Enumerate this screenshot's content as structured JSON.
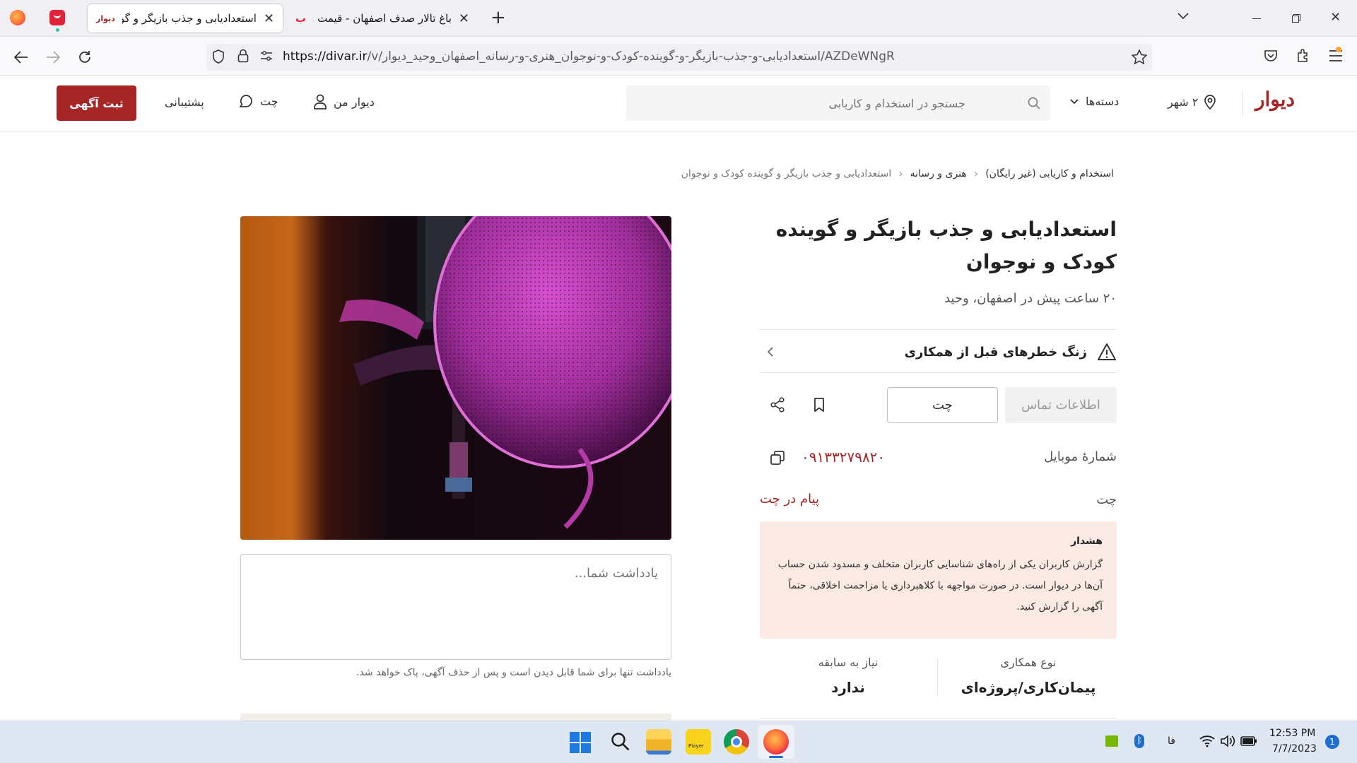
{
  "browser": {
    "tabs": [
      {
        "title": "استعدادیابی و جذب بازیگر و گو",
        "favicon_text": "دیوار",
        "active": true
      },
      {
        "title": "باغ تالار صدف اصفهان - قیمت و",
        "favicon_text": "ب",
        "active": false
      }
    ],
    "new_tab_symbol": "+",
    "url_host": "https://divar.ir",
    "url_path": "/v/استعدادیابی-و-جذب-بازیگر-و-گوینده-کودک-و-نوجوان_هنری-و-رسانه_اصفهان_وحید_دیوار/AZDeWNgR"
  },
  "header": {
    "logo": "دیوار",
    "city": "۲ شهر",
    "categories": "دسته‌ها",
    "search_placeholder": "جستجو در استخدام و کاریابی",
    "my_divar": "دیوار من",
    "chat": "چت",
    "support": "پشتیبانی",
    "post_ad": "ثبت آگهی"
  },
  "breadcrumb": [
    "استخدام و کاریابی (غیر رایگان)",
    "هنری و رسانه",
    "استعدادیابی و جذب بازیگر و گوینده کودک و نوجوان"
  ],
  "ad": {
    "title": "استعدادیابی و جذب بازیگر و گوینده کودک و نوجوان",
    "subtitle": "۲۰ ساعت پیش در اصفهان، وحید",
    "alert_text": "زنگ خطرهای قبل از همکاری",
    "contact_button": "اطلاعات تماس",
    "chat_button": "چت",
    "mobile_label": "شمارهٔ موبایل",
    "mobile_value": "۰۹۱۳۳۲۷۹۸۲۰",
    "chat_label": "چت",
    "chat_link": "پیام در چت",
    "warning_title": "هشدار",
    "warning_text": "گزارش کاربران یکی از راه‌های شناسایی کاربران متخلف و مسدود شدن حساب آن‌ها در دیوار است. در صورت مواجهه با کلاهبرداری یا مزاحمت اخلاقی، حتماً آگهی را گزارش کنید.",
    "stats": [
      {
        "label": "نوع همکاری",
        "value": "پیمان‌کاری/پروژه‌ای"
      },
      {
        "label": "نیاز به سابقه",
        "value": "ندارد"
      }
    ]
  },
  "notes": {
    "placeholder": "یادداشت شما...",
    "hint": "یادداشت تنها برای شما قابل دیدن است و پس از حذف آگهی، پاک خواهد شد."
  },
  "taskbar": {
    "language": "فا",
    "time": "12:53 PM",
    "date": "7/7/2023",
    "notification_count": "1",
    "player_label": "Player"
  },
  "colors": {
    "brand": "#a62626",
    "warning_bg": "#fbe9e3",
    "taskbar_bg": "#dfe7f3"
  }
}
